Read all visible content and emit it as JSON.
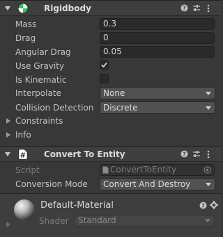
{
  "rigidbody": {
    "title": "Rigidbody",
    "icon": "rigidbody-icon",
    "fields": {
      "mass": {
        "label": "Mass",
        "value": "0.3"
      },
      "drag": {
        "label": "Drag",
        "value": "0"
      },
      "angular_drag": {
        "label": "Angular Drag",
        "value": "0.05"
      },
      "use_gravity": {
        "label": "Use Gravity",
        "checked": true
      },
      "is_kinematic": {
        "label": "Is Kinematic",
        "checked": false
      },
      "interpolate": {
        "label": "Interpolate",
        "value": "None"
      },
      "collision_detection": {
        "label": "Collision Detection",
        "value": "Discrete"
      }
    },
    "foldouts": {
      "constraints": "Constraints",
      "info": "Info"
    }
  },
  "convert_to_entity": {
    "title": "Convert To Entity",
    "icon": "script-hash-icon",
    "script": {
      "label": "Script",
      "value": "ConvertToEntity"
    },
    "conversion_mode": {
      "label": "Conversion Mode",
      "value": "Convert And Destroy"
    }
  },
  "material": {
    "name": "Default-Material",
    "shader_label": "Shader",
    "shader_value": "Standard"
  },
  "colors": {
    "background": "#383838",
    "header": "#3e3e3e",
    "field": "#2a2a2a",
    "dropdown": "#515151",
    "rigidbody_icon": "#2ec94a"
  }
}
